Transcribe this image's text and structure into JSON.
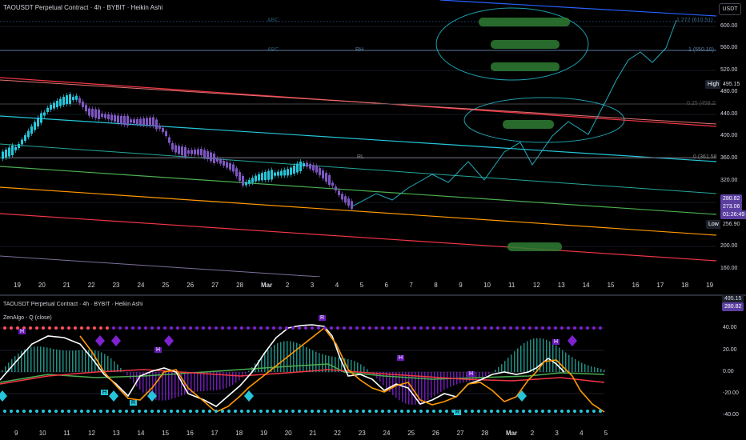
{
  "main": {
    "title": "TAOUSDT Perpetual Contract · 4h · BYBIT · Heikin Ashi",
    "currency_button": "USDT",
    "price_ticks": [
      "600.00",
      "560.00",
      "520.00",
      "480.00",
      "440.00",
      "400.00",
      "360.00",
      "320.00",
      "280.00",
      "240.00",
      "200.00",
      "160.00"
    ],
    "time_ticks": [
      "19",
      "20",
      "21",
      "22",
      "23",
      "24",
      "25",
      "26",
      "27",
      "28",
      "Mar",
      "2",
      "3",
      "4",
      "5",
      "6",
      "7",
      "8",
      "9",
      "10",
      "11",
      "12",
      "13",
      "14",
      "15",
      "16",
      "17",
      "18",
      "19"
    ],
    "high_label": "High",
    "high_value": "495.15",
    "current_price": "280.82",
    "current_price_sub": "273.06",
    "countdown": "01:26:49",
    "low_label": "Low",
    "low_value": "256.90",
    "level_labels": {
      "abc_top": "ABC",
      "abc_mid": "ABC",
      "rh": "RH",
      "rl": "RL",
      "fib_1272": "1.272 (610.51)",
      "fib_1": "1 (550.10)",
      "fib_025": "0.25 (458.27)",
      "fib_0": "0 (361.58)"
    }
  },
  "osc": {
    "title": "TAOUSDT Perpetual Contract · 4h · BYBIT · Heikin Ashi",
    "indicator": "ZenAlgo - Q (close)",
    "high_value": "495.15",
    "price_value": "280.82",
    "ticks": [
      "40.00",
      "20.00",
      "0.00",
      "-20.00",
      "-40.00"
    ],
    "time_ticks": [
      "9",
      "10",
      "11",
      "12",
      "13",
      "14",
      "15",
      "16",
      "17",
      "18",
      "19",
      "20",
      "21",
      "22",
      "23",
      "24",
      "25",
      "26",
      "27",
      "28",
      "Mar",
      "2",
      "3",
      "4",
      "5"
    ],
    "markers": {
      "h1": "H",
      "h2": "H",
      "h3": "H",
      "h4": "H",
      "h5": "H",
      "h6": "H",
      "r1": "R",
      "r2": "R",
      "r3": "R",
      "r4": "R"
    }
  },
  "colors": {
    "background": "#000000",
    "bull_candle": "#26c6da",
    "bear_candle": "#7e57c2",
    "red_line": "#f23645",
    "orange_line": "#ff9800",
    "green_line": "#4caf50",
    "cyan_line": "#26c6da",
    "blue_line": "#2962ff",
    "marker_green": "#2e7d32"
  }
}
